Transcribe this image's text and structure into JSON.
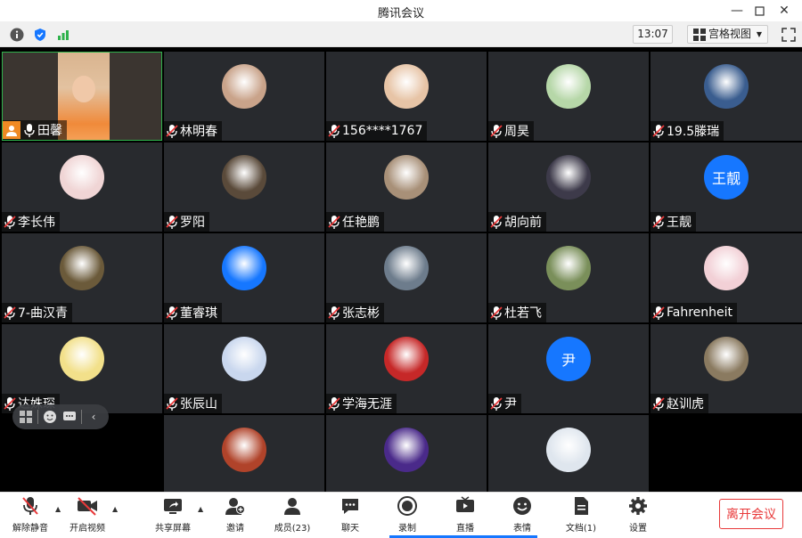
{
  "window": {
    "title": "腾讯会议"
  },
  "infobar": {
    "clock": "13:07",
    "view_label": "宫格视图"
  },
  "participants": [
    {
      "name": "田馨",
      "mic": "on"
    },
    {
      "name": "林明春",
      "mic": "off"
    },
    {
      "name": "156****1767",
      "mic": "off"
    },
    {
      "name": "周昊",
      "mic": "off"
    },
    {
      "name": "19.5滕瑞",
      "mic": "off"
    },
    {
      "name": "李长伟",
      "mic": "off"
    },
    {
      "name": "罗阳",
      "mic": "off"
    },
    {
      "name": "任艳鹏",
      "mic": "off"
    },
    {
      "name": "胡向前",
      "mic": "off"
    },
    {
      "name": "王靓",
      "mic": "off",
      "avatar_text": "王靓"
    },
    {
      "name": "7-曲汉青",
      "mic": "off"
    },
    {
      "name": "董睿琪",
      "mic": "off"
    },
    {
      "name": "张志彬",
      "mic": "off"
    },
    {
      "name": "杜若飞",
      "mic": "off"
    },
    {
      "name": "Fahrenheit",
      "mic": "off"
    },
    {
      "name": "达姝琛",
      "mic": "off"
    },
    {
      "name": "张辰山",
      "mic": "off"
    },
    {
      "name": "学海无涯",
      "mic": "off"
    },
    {
      "name": "尹",
      "mic": "off",
      "avatar_text": "尹"
    },
    {
      "name": "赵训虎",
      "mic": "off"
    }
  ],
  "toolbar": {
    "unmute": "解除静音",
    "start_video": "开启视频",
    "share_screen": "共享屏幕",
    "invite": "邀请",
    "members": "成员(23)",
    "chat": "聊天",
    "record": "录制",
    "live": "直播",
    "reactions": "表情",
    "docs": "文档(1)",
    "settings": "设置",
    "leave": "离开会议"
  },
  "colors": {
    "accent": "#1677ff",
    "leave": "#e8393a",
    "tile_bg": "#282a2e",
    "self_border": "#2fb24c"
  }
}
